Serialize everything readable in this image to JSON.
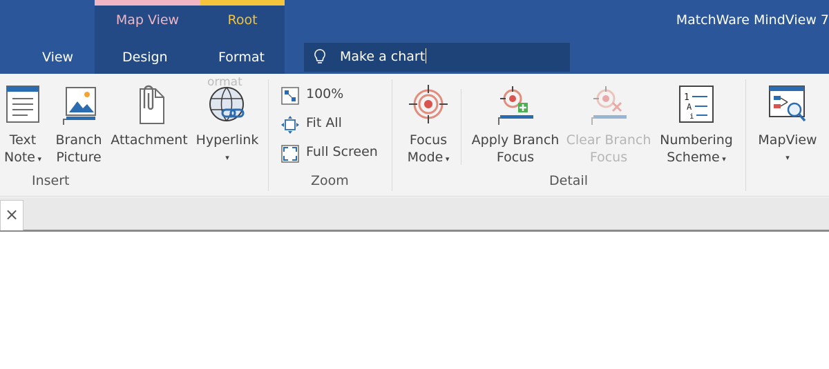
{
  "title_bar": {
    "app_title": "MatchWare MindView 7",
    "context_groups": [
      {
        "label": "Map View",
        "accent_color": "#f0b6c3",
        "label_color": "#f0b6c3"
      },
      {
        "label": "Root",
        "accent_color": "#f3c43c",
        "label_color": "#f3c43c"
      }
    ],
    "tabs": [
      "View",
      "Design",
      "Format"
    ],
    "tell_me": {
      "icon": "lightbulb-icon",
      "value": "Make a chart"
    }
  },
  "ribbon": {
    "insert": {
      "label": "Insert",
      "buttons": [
        {
          "icon": "text-note-icon",
          "line1": "Text",
          "line2": "Note",
          "has_dropdown": true
        },
        {
          "icon": "branch-picture-icon",
          "line1": "Branch",
          "line2": "Picture",
          "has_dropdown": false
        },
        {
          "icon": "attachment-icon",
          "line1": "Attachment",
          "line2": "",
          "has_dropdown": false
        },
        {
          "icon": "hyperlink-icon",
          "line1": "Hyperlink",
          "line2": "",
          "has_dropdown": true,
          "tooltip_fragment": "ormat"
        }
      ]
    },
    "zoom": {
      "label": "Zoom",
      "buttons": [
        {
          "icon": "zoom-100-icon",
          "label": "100%"
        },
        {
          "icon": "fit-all-icon",
          "label": "Fit All"
        },
        {
          "icon": "full-screen-icon",
          "label": "Full Screen"
        }
      ]
    },
    "detail": {
      "label": "Detail",
      "buttons": [
        {
          "icon": "focus-target-icon",
          "line1": "Focus",
          "line2": "Mode",
          "has_dropdown": true,
          "enabled": true
        },
        {
          "icon": "apply-branch-focus-icon",
          "line1": "Apply Branch",
          "line2": "Focus",
          "enabled": true
        },
        {
          "icon": "clear-branch-focus-icon",
          "line1": "Clear Branch",
          "line2": "Focus",
          "enabled": false
        },
        {
          "icon": "numbering-scheme-icon",
          "line1": "Numbering",
          "line2": "Scheme",
          "has_dropdown": true,
          "enabled": true
        }
      ]
    },
    "mapview": {
      "icon": "mapview-icon",
      "line1": "MapView",
      "has_dropdown": true
    }
  },
  "document_tabs": {
    "close_glyph": "×"
  },
  "colors": {
    "title_bar": "#2b579a",
    "context_tab_bg": "#234a85",
    "ribbon_bg": "#f3f3f3",
    "disabled_text": "#b5b5b5"
  }
}
